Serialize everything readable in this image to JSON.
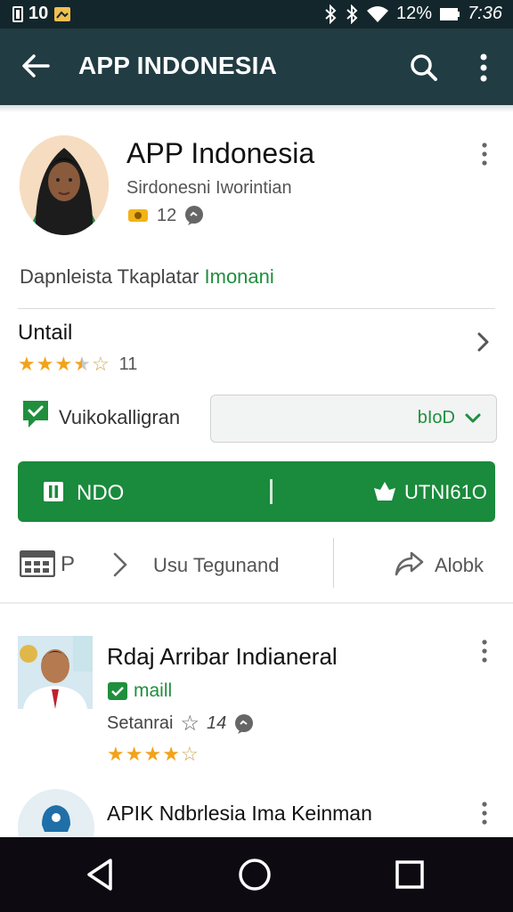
{
  "status_bar": {
    "left_text": "10",
    "battery": "12%",
    "time": "7:36"
  },
  "app_bar": {
    "title": "APP INDONESIA",
    "icons": [
      "back-arrow-icon",
      "search-icon",
      "more-vert-icon"
    ]
  },
  "app": {
    "name": "APP Indonesia",
    "developer": "Sirdonesni Iworintian",
    "count": "12",
    "description_text": "Dapnleista Tkaplatar",
    "description_highlight": "Imonani"
  },
  "rating_section": {
    "title": "Untail",
    "rating": 3.5,
    "rating_count": "11"
  },
  "feature": {
    "label": "Vuikokalligran",
    "dropdown_value": "bIoD"
  },
  "install_bar": {
    "left_label": "NDO",
    "right_label": "UTNI61O"
  },
  "actions": {
    "middle_label": "Usu Tegunand",
    "right_label": "Alobk",
    "left_letter": "P"
  },
  "list_items": [
    {
      "title": "Rdaj Arribar Indianeral",
      "tag": "maill",
      "meta": "Setanrai",
      "count": "14",
      "rating": 4
    },
    {
      "title": "APIK Ndbrlesia Ima Keinman"
    }
  ],
  "colors": {
    "app_bar": "#213c42",
    "status_bar": "#13262b",
    "accent_green": "#1a8a3c",
    "star": "#f2a31b",
    "nav_bar": "#0e0a12"
  }
}
